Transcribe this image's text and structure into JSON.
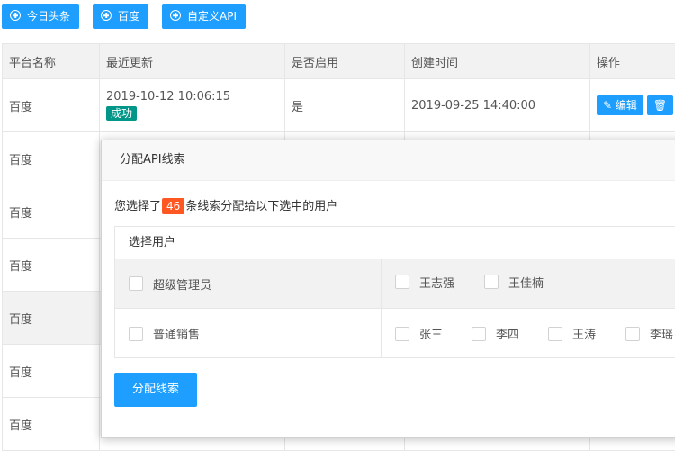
{
  "toolbar": {
    "buttons": [
      {
        "label": "今日头条"
      },
      {
        "label": "百度"
      },
      {
        "label": "自定义API"
      }
    ]
  },
  "table": {
    "headers": [
      "平台名称",
      "最近更新",
      "是否启用",
      "创建时间",
      "操作"
    ],
    "first_row": {
      "platform": "百度",
      "updated": "2019-10-12 10:06:15",
      "status": "成功",
      "enabled": "是",
      "created": "2019-09-25 14:40:00",
      "edit_label": "编辑",
      "delete_label": ""
    },
    "other_rows": [
      "百度",
      "百度",
      "百度",
      "百度",
      "百度",
      "百度"
    ]
  },
  "modal": {
    "title": "分配API线索",
    "desc_prefix": "您选择了",
    "count": "46",
    "desc_suffix": "条线索分配给以下选中的用户",
    "panel_title": "选择用户",
    "groups": [
      {
        "label": "超级管理员",
        "users": [
          "王志强",
          "王佳楠"
        ]
      },
      {
        "label": "普通销售",
        "users": [
          "张三",
          "李四",
          "王涛",
          "李瑶"
        ]
      }
    ],
    "submit_label": "分配线索"
  },
  "colors": {
    "primary": "#1e9fff",
    "success_badge": "#009688",
    "count_badge": "#ff5722",
    "header_bg": "#f2f2f2"
  }
}
